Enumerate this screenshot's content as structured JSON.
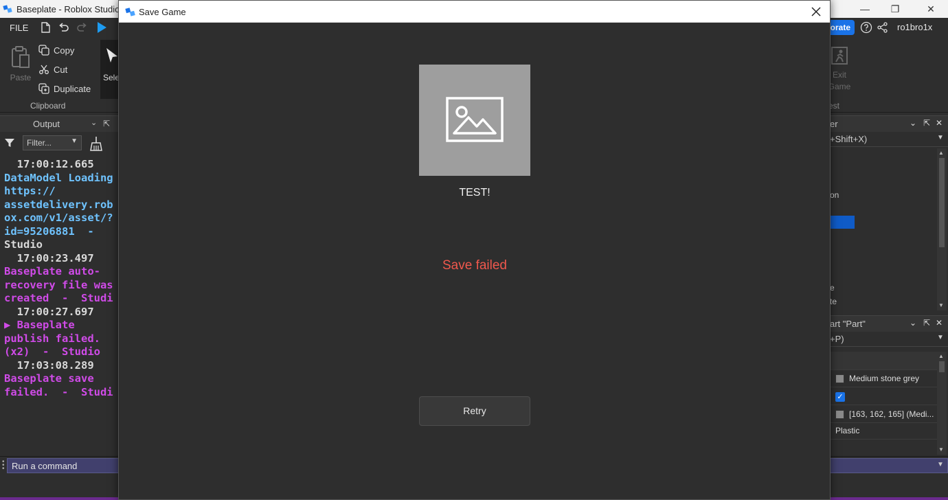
{
  "window": {
    "title": "Baseplate - Roblox Studio"
  },
  "menubar": {
    "file": "FILE",
    "collaborate_label": "orate",
    "username": "ro1bro1x"
  },
  "ribbon": {
    "paste_label": "Paste",
    "copy_label": "Copy",
    "cut_label": "Cut",
    "duplicate_label": "Duplicate",
    "clipboard_caption": "Clipboard",
    "select_label": "Sele",
    "exit_game_label_1": "Exit",
    "exit_game_label_2": "Game",
    "test_caption": "est"
  },
  "output_panel": {
    "title": "Output",
    "filter_placeholder": "Filter...",
    "log_lines": [
      {
        "kind": "t",
        "text": "  17:00:12.665"
      },
      {
        "kind": "c",
        "text": "DataModel Loading"
      },
      {
        "kind": "c",
        "text": "https://"
      },
      {
        "kind": "c",
        "text": "assetdelivery.rob"
      },
      {
        "kind": "c",
        "text": "ox.com/v1/asset/?"
      },
      {
        "kind": "c",
        "text": "id=95206881  -"
      },
      {
        "kind": "t",
        "text": "Studio"
      },
      {
        "kind": "t",
        "text": "  17:00:23.497"
      },
      {
        "kind": "m",
        "text": "Baseplate auto-"
      },
      {
        "kind": "m",
        "text": "recovery file was"
      },
      {
        "kind": "m",
        "text": "created  -  Studi"
      },
      {
        "kind": "t",
        "text": "  17:00:27.697"
      },
      {
        "kind": "m",
        "text": "▶ Baseplate"
      },
      {
        "kind": "m",
        "text": "publish failed."
      },
      {
        "kind": "m",
        "text": "(x2)  -  Studio"
      },
      {
        "kind": "t",
        "text": "  17:03:08.289"
      },
      {
        "kind": "m",
        "text": "Baseplate save"
      },
      {
        "kind": "m",
        "text": "failed.  -  Studi"
      }
    ]
  },
  "explorer": {
    "title": "er",
    "filter_text": "+Shift+X)",
    "row_on": "on",
    "row_e": "e",
    "row_te": "te"
  },
  "properties": {
    "title": "art \"Part\"",
    "filter_text": "+P)",
    "rows": [
      {
        "value": "Medium stone grey"
      },
      {
        "value": ""
      },
      {
        "value": "[163, 162, 165] (Medi..."
      },
      {
        "value": "Plastic"
      }
    ]
  },
  "command_bar": {
    "placeholder": "Run a command"
  },
  "dialog": {
    "title": "Save Game",
    "game_name": "TEST!",
    "status": "Save failed",
    "retry_label": "Retry"
  },
  "colors": {
    "status_error": "#f0584d",
    "accent_blue": "#1a73e8",
    "log_cyan": "#6fc3ff",
    "log_magenta": "#d04be8"
  }
}
